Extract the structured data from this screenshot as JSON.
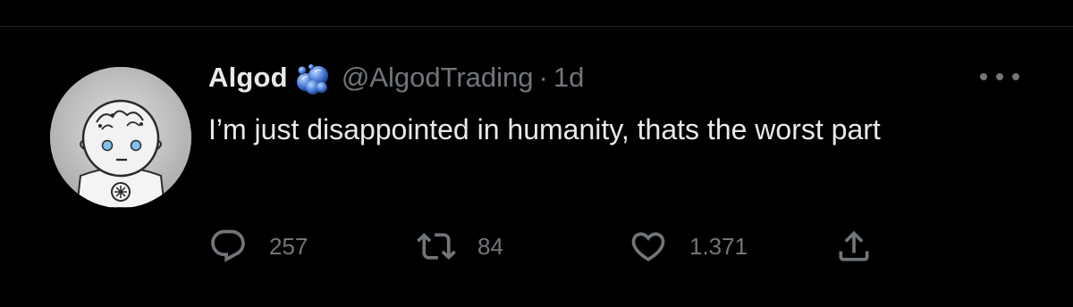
{
  "tweet": {
    "author_name": "Algod",
    "handle": "@AlgodTrading",
    "separator": "·",
    "time": "1d",
    "text": "I’m just disappointed in humanity, thats the worst part",
    "badge_icon": "blue-bubbles-emoji",
    "more_icon": "more-dots-icon"
  },
  "actions": {
    "reply": {
      "icon": "reply-icon",
      "count": "257"
    },
    "retweet": {
      "icon": "retweet-icon",
      "count": "84"
    },
    "like": {
      "icon": "heart-icon",
      "count": "1.371"
    },
    "share": {
      "icon": "share-icon"
    }
  },
  "colors": {
    "background": "#000000",
    "text_primary": "#e7e9ea",
    "text_secondary": "#71767b",
    "badge_blue": "#4a7fd8"
  }
}
